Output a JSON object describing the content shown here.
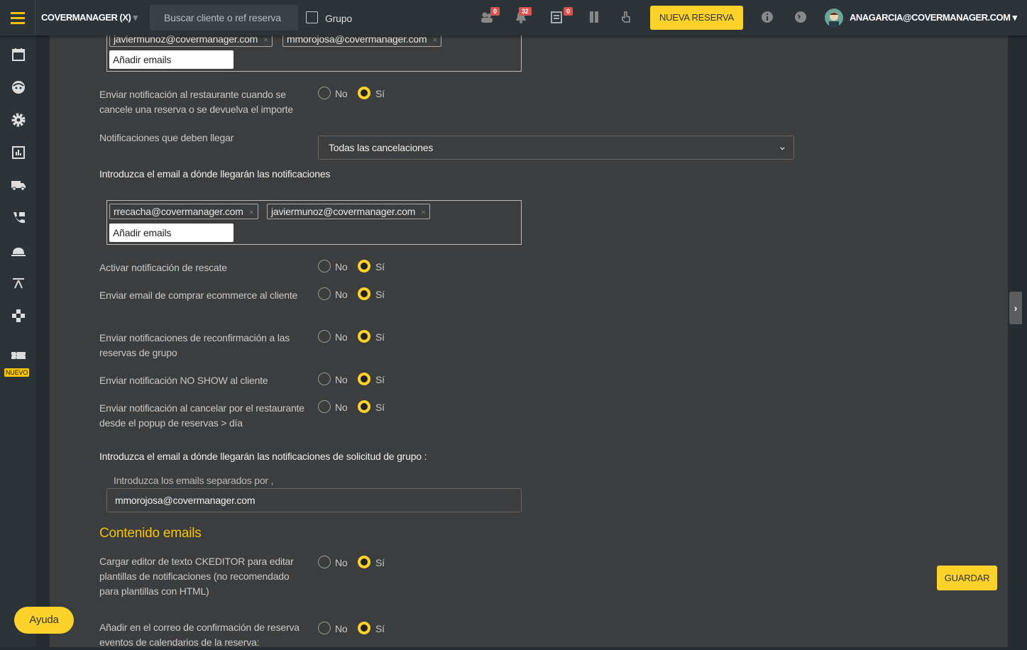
{
  "topbar": {
    "brand": "COVERMANAGER (X)",
    "search_placeholder": "Buscar cliente o ref reserva",
    "group_label": "Grupo",
    "badges": {
      "groups": "0",
      "alerts": "32",
      "notes": "0"
    },
    "new_booking": "NUEVA RESERVA",
    "user": "ANAGARCIA@COVERMANAGER.COM"
  },
  "sidebar": {
    "icons": [
      "calendar-icon",
      "face-icon",
      "gear-icon",
      "chart-icon",
      "truck-icon",
      "phone-icon",
      "cloche-icon",
      "table-icon",
      "gamepad-icon",
      "ticket-icon"
    ],
    "new_badge": "NUEVO"
  },
  "radio": {
    "no": "No",
    "yes": "Sí"
  },
  "form": {
    "top_tags": [
      "javiermunoz@covermanager.com",
      "mmorojosa@covermanager.com"
    ],
    "add_emails": "Añadir emails",
    "notify_cancel": {
      "label": "Enviar notificación al restaurante cuando se cancele una reserva o se devuelva el importe",
      "value": "Sí"
    },
    "notif_type": {
      "label": "Notificaciones que deben llegar",
      "value": "Todas las cancelaciones"
    },
    "email_dest_label": "Introduzca el email a dónde llegarán las notificaciones",
    "dest_tags": [
      "rrecacha@covermanager.com",
      "javiermunoz@covermanager.com"
    ],
    "rescue": {
      "label": "Activar notificación de rescate",
      "value": "Sí"
    },
    "ecommerce": {
      "label": "Enviar email de comprar ecommerce al cliente",
      "value": "Sí"
    },
    "reconfirm": {
      "label": "Enviar notificaciones de reconfirmación a las reservas de grupo",
      "value": "Sí"
    },
    "noshow": {
      "label": "Enviar notificación NO SHOW al cliente",
      "value": "Sí"
    },
    "cancel_popup": {
      "label": "Enviar notificación al cancelar por el restaurante desde el popup de reservas > día",
      "value": "Sí"
    },
    "group_email_label": "Introduzca el email a dónde llegarán las notificaciones de solicitud de grupo :",
    "group_email_help": "Introduzca los emails separados por ,",
    "group_email_value": "mmorojosa@covermanager.com",
    "section_title": "Contenido emails",
    "ckeditor": {
      "label": "Cargar editor de texto CKEDITOR para editar plantillas de notificaciones (no recomendado para plantillas con HTML)",
      "value": "Sí"
    },
    "calendar_events": {
      "label": "Añadir en el correo de confirmación de reserva eventos de calendarios de la reserva:",
      "value": "Sí"
    }
  },
  "buttons": {
    "save": "GUARDAR",
    "help": "Ayuda"
  },
  "colors": {
    "accent": "#fdd22a",
    "badge": "#d9534f",
    "content_bg": "#3b3d3f",
    "bar_bg": "#2c3339"
  }
}
